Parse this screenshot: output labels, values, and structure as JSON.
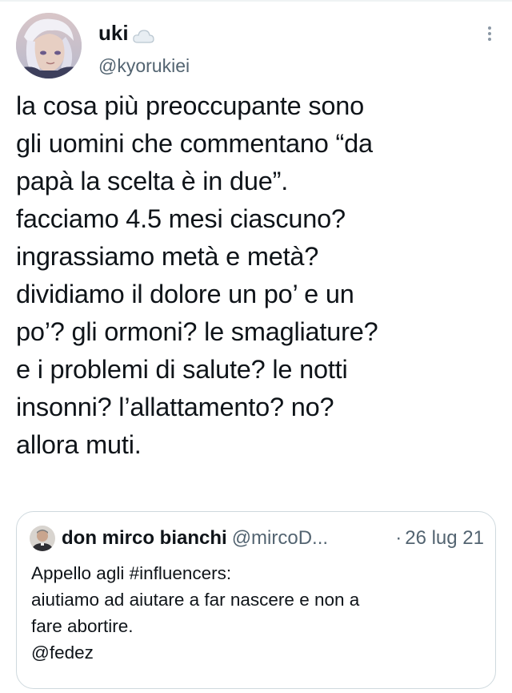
{
  "tweet": {
    "author": {
      "display_name": "uki",
      "handle": "@kyorukiei",
      "name_icon": "cloud-icon",
      "avatar_icon": "anime-avatar"
    },
    "menu_icon": "more-options-icon",
    "text_lines": [
      "la cosa più preoccupante sono",
      "gli uomini che commentano “da",
      "papà la scelta è in due”.",
      "facciamo 4.5 mesi ciascuno?",
      "ingrassiamo metà e metà?",
      "dividiamo il dolore un po’ e un",
      "po’? gli ormoni? le smagliature?",
      "e i problemi di salute? le notti",
      "insonni? l’allattamento? no?",
      "allora muti."
    ]
  },
  "quoted_tweet": {
    "display_name": "don mirco bianchi",
    "handle": "@mircoD...",
    "separator": "·",
    "date": "26 lug 21",
    "text_lines": [
      "Appello agli #influencers:",
      "aiutiamo ad aiutare a far nascere e non a",
      "fare abortire.",
      "@fedez"
    ]
  }
}
